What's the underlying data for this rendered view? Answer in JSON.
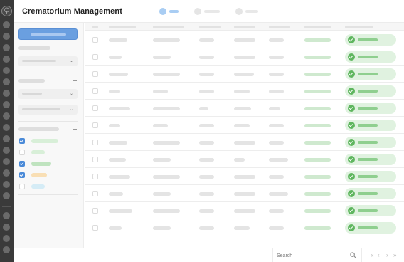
{
  "app": {
    "title": "Crematorium Management"
  },
  "header_tabs": [
    {
      "icon": "circle-icon",
      "state": "active",
      "color": "#a9cdf3"
    },
    {
      "icon": "circle-icon",
      "state": "inactive",
      "color": "#e5e5e5"
    },
    {
      "icon": "circle-icon",
      "state": "inactive",
      "color": "#e5e5e5"
    }
  ],
  "sidebar": {
    "filter_groups": [
      {
        "control": "dropdown",
        "chevron": "⌄"
      },
      {
        "control": "dropdown",
        "chevron": "⌄"
      },
      {
        "control": "dropdown",
        "chevron": "⌄"
      }
    ],
    "checkbox_options": [
      {
        "checked": true,
        "chip_color": "#d8efd8"
      },
      {
        "checked": false,
        "chip_color": "#d8efd8"
      },
      {
        "checked": true,
        "chip_color": "#bfe3bf"
      },
      {
        "checked": true,
        "chip_color": "#f9dfb5"
      },
      {
        "checked": false,
        "chip_color": "#d5ecf6"
      }
    ]
  },
  "table": {
    "rows": [
      {
        "status": "complete",
        "status_icon": "check-circle-icon"
      },
      {
        "status": "complete",
        "status_icon": "check-circle-icon"
      },
      {
        "status": "complete",
        "status_icon": "check-circle-icon"
      },
      {
        "status": "complete",
        "status_icon": "check-circle-icon"
      },
      {
        "status": "complete",
        "status_icon": "check-circle-icon"
      },
      {
        "status": "complete",
        "status_icon": "check-circle-icon"
      },
      {
        "status": "complete",
        "status_icon": "check-circle-icon"
      },
      {
        "status": "complete",
        "status_icon": "check-circle-icon"
      },
      {
        "status": "complete",
        "status_icon": "check-circle-icon"
      },
      {
        "status": "complete",
        "status_icon": "check-circle-icon"
      },
      {
        "status": "complete",
        "status_icon": "check-circle-icon"
      },
      {
        "status": "complete",
        "status_icon": "check-circle-icon"
      }
    ]
  },
  "footer": {
    "search_placeholder": "Search",
    "search_icon": "search-icon",
    "pager": {
      "first": "«",
      "prev": "‹",
      "next": "›",
      "last": "»"
    }
  },
  "colors": {
    "rail": "#3a3a3a",
    "primary_button": "#6a9fe0",
    "status_success": "#5fb65f",
    "status_success_bg": "#e0f2e0",
    "checkbox_checked": "#4a8ad8"
  }
}
